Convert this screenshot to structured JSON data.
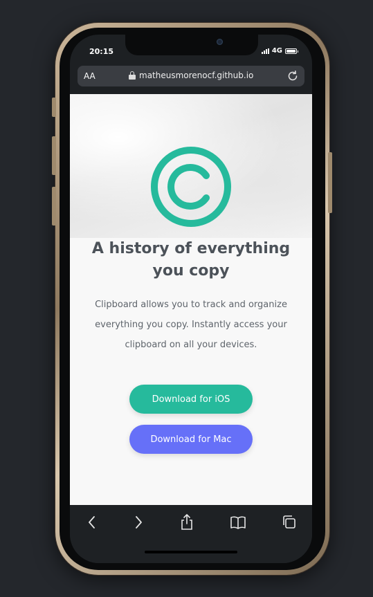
{
  "status_bar": {
    "time": "20:15",
    "network": "4G"
  },
  "browser": {
    "text_size_label": "AA",
    "url": "matheusmorenocf.github.io"
  },
  "page": {
    "logo": "copyright-c-icon",
    "headline": "A history of everything you copy",
    "description": "Clipboard allows you to track and organize everything you copy. Instantly access your clipboard on all your devices.",
    "buttons": {
      "ios": "Download for iOS",
      "mac": "Download for Mac"
    }
  },
  "toolbar": {
    "icons": [
      "back-icon",
      "forward-icon",
      "share-icon",
      "bookmarks-icon",
      "tabs-icon"
    ]
  },
  "colors": {
    "accent_teal": "#26ba9c",
    "accent_blue": "#6670f8",
    "heading": "#4c5259",
    "body_text": "#5e646b",
    "background": "#24272c"
  }
}
